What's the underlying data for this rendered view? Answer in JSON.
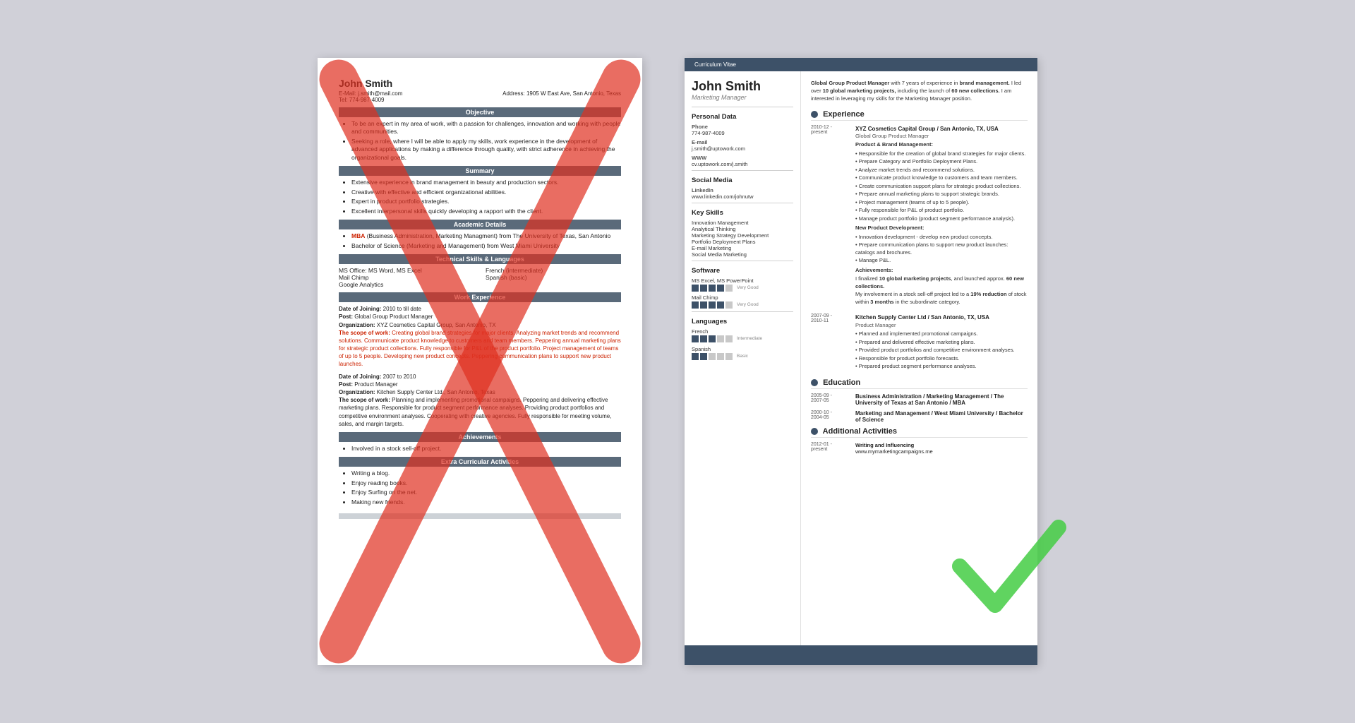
{
  "left_resume": {
    "name": "John Smith",
    "email_label": "E-Mail:",
    "email": "j.smith@mail.com",
    "address_label": "Address:",
    "address": "1905 W East Ave, San Antonio, Texas",
    "tel_label": "Tel:",
    "tel": "774-987-4009",
    "sections": {
      "objective": {
        "header": "Objective",
        "bullets": [
          "To be an expert in my area of work, with a passion for challenges, innovation and working with people and communities.",
          "Seeking a role, where I will be able to apply my skills, work experience in the development of advanced applications by making a difference through quality, with strict adherence in achieving the organizational goals."
        ]
      },
      "summary": {
        "header": "Summary",
        "bullets": [
          "Extensive experience in brand management in beauty and production sectors.",
          "Creative with effective and efficient organizational abilities.",
          "Expert in product portfolio strategies.",
          "Excellent interpersonal skills quickly developing a rapport with the client."
        ]
      },
      "academic": {
        "header": "Academic Details",
        "bullets": [
          "MBA (Business Administration, Marketing Managment) from The University of Texas, San Antonio",
          "Bachelor of Science (Marketing and Management) from West Miami University"
        ]
      },
      "technical": {
        "header": "Technical Skills & Languages",
        "skills_left": [
          "MS Office: MS Word, MS Excel",
          "Mail Chimp",
          "Google Analytics"
        ],
        "skills_right": [
          "French (intermediate)",
          "Spanish (basic)"
        ]
      },
      "work": {
        "header": "Work Experience",
        "entries": [
          {
            "date_joining": "Date of Joining: 2010 to till date",
            "post": "Post: Global Group Product Manager",
            "org": "Organization: XYZ Cosmetics Capital Group, San Antonio, TX",
            "scope": "The scope of work: Creating global brand strategies for major clients. Analyzing market trends and recommend solutions. Communicate product knowledge to customers and team members. Peppering annual marketing plans for strategic product collections. Fully responsible for P&L of the product portfolio. Project management of teams of up to 5 people. Developing new product concepts. Peppering communication plans to support new product launches."
          },
          {
            "date_joining": "Date of Joining: 2007 to 2010",
            "post": "Post: Product Manager",
            "org": "Organization: Kitchen Supply Center Ltd., San Antonio, Texas",
            "scope": "The scope of work: Planning and implementing promotional campaigns. Peppering and delivering effective marketing plans. Responsible for product segment performance analyses. Providing product portfolios and competitive environment analyses. Cooperating with creative agencies. Fully responsible for meeting volume, sales, and margin targets."
          }
        ]
      },
      "achievements": {
        "header": "Achievements",
        "bullets": [
          "Involved in a stock sell-off project."
        ]
      },
      "extra": {
        "header": "Extra Curricular Activities",
        "bullets": [
          "Writing a blog.",
          "Enjoy reading books.",
          "Enjoy Surfing on the net.",
          "Making new friends."
        ]
      }
    }
  },
  "right_resume": {
    "cv_label": "Curriculum Vitae",
    "name": "John Smith",
    "title": "Marketing Manager",
    "sidebar": {
      "personal_data_title": "Personal Data",
      "phone_label": "Phone",
      "phone": "774-987-4009",
      "email_label": "E-mail",
      "email": "j.smith@uptowork.com",
      "www_label": "WWW",
      "www": "cv.uptowork.com/j.smith",
      "social_media_title": "Social Media",
      "linkedin_label": "LinkedIn",
      "linkedin": "www.linkedin.com/johnutw",
      "key_skills_title": "Key Skills",
      "key_skills": [
        "Innovation Management",
        "Analytical Thinking",
        "Marketing Strategy Development",
        "Portfolio Deployment Plans",
        "E-mail Marketing",
        "Social Media Marketing"
      ],
      "software_title": "Software",
      "software": [
        {
          "name": "MS Excel, MS PowerPoint",
          "level": 4,
          "total": 5,
          "label": "Very Good"
        },
        {
          "name": "Mail Chimp",
          "level": 4,
          "total": 5,
          "label": "Very Good"
        }
      ],
      "languages_title": "Languages",
      "languages": [
        {
          "name": "French",
          "level": 3,
          "total": 5,
          "label": "Intermediate"
        },
        {
          "name": "Spanish",
          "level": 2,
          "total": 5,
          "label": "Basic"
        }
      ]
    },
    "main": {
      "intro": "Global Group Product Manager with 7 years of experience in brand management. I led over 10 global marketing projects, including the launch of 60 new collections. I am interested in leveraging my skills for the Marketing Manager position.",
      "experience_title": "Experience",
      "experience": [
        {
          "dates": "2010-12 -\npresent",
          "company": "XYZ Cosmetics Capital Group / San Antonio, TX, USA",
          "role": "Global Group Product Manager",
          "subsection": "Product & Brand Management:",
          "bullets": [
            "Responsible for the creation of global brand strategies for major clients.",
            "Prepare Category and Portfolio Deployment Plans.",
            "Analyze market trends and recommend solutions.",
            "Communicate product knowledge to customers and team members.",
            "Create communication support plans for strategic product collections.",
            "Prepare annual marketing plans to support strategic brands.",
            "Project management (teams of up to 5 people).",
            "Fully responsible for P&L of product portfolio.",
            "Manage product portfolio (product segment performance analysis)."
          ],
          "subsection2": "New Product Development:",
          "bullets2": [
            "Innovation development - develop new product concepts.",
            "Prepare communication plans to support new product launches: catalogs and brochures.",
            "Manage P&L."
          ],
          "subsection3": "Achievements:",
          "bullets3": [
            "I finalized 10 global marketing projects, and launched approx. 60 new collections.",
            "My involvement in a stock sell-off project led to a 19% reduction of stock within 3 months in the subordinate category."
          ]
        },
        {
          "dates": "2007-09 -\n2010-11",
          "company": "Kitchen Supply Center Ltd / San Antonio, TX, USA",
          "role": "Product Manager",
          "bullets": [
            "Planned and implemented promotional campaigns.",
            "Prepared and delivered effective marketing plans.",
            "Provided product portfolios and competitive environment analyses.",
            "Responsible for product portfolio forecasts.",
            "Prepared product segment performance analyses."
          ]
        }
      ],
      "education_title": "Education",
      "education": [
        {
          "dates": "2005-09 -\n2007-05",
          "degree": "Business Administration / Marketing Management / The University of Texas at San Antonio / MBA"
        },
        {
          "dates": "2000-10 -\n2004-05",
          "degree": "Marketing and Management / West Miami University / Bachelor of Science"
        }
      ],
      "additional_title": "Additional Activities",
      "additional": [
        {
          "dates": "2012-01 -\npresent",
          "activity": "Writing and Influencing",
          "detail": "www.mymarketingcampaigns.me"
        }
      ]
    }
  }
}
